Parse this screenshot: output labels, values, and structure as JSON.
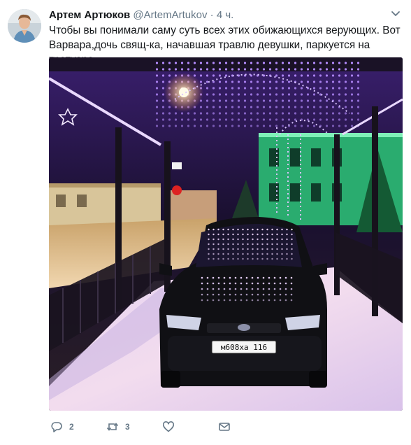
{
  "tweet": {
    "display_name": "Артем Артюков",
    "handle": "@ArtemArtukov",
    "separator": "·",
    "time": "4 ч.",
    "text": "Чтобы вы понимали саму суть всех этих обижающихся верующих. Вот Варвара,дочь свящ-ка, начавшая травлю девушки, паркуется на тротуаре",
    "media": {
      "car_plate": "м608ха 116"
    }
  },
  "actions": {
    "reply": {
      "icon": "reply-icon",
      "count": "2"
    },
    "retweet": {
      "icon": "retweet-icon",
      "count": "3"
    },
    "like": {
      "icon": "heart-icon",
      "count": ""
    },
    "dm": {
      "icon": "envelope-icon"
    }
  },
  "colors": {
    "name": "#14171a",
    "secondary": "#657786",
    "lights": "#b58cff",
    "building_green": "#34e08a"
  }
}
